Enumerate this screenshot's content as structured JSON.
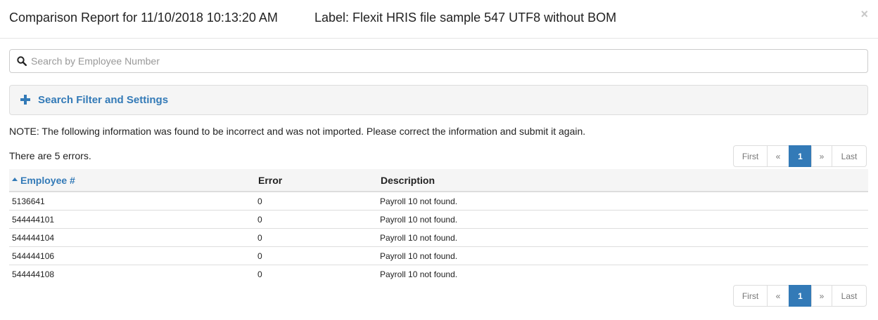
{
  "header": {
    "title": "Comparison Report for 11/10/2018 10:13:20 AM",
    "label": "Label: Flexit HRIS file sample 547 UTF8 without BOM",
    "close_glyph": "×"
  },
  "search": {
    "placeholder": "Search by Employee Number",
    "value": ""
  },
  "filter_panel": {
    "label": "Search Filter and Settings",
    "icon": "plus-icon"
  },
  "note": "NOTE: The following information was found to be incorrect and was not imported. Please correct the information and submit it again.",
  "error_count_text": "There are 5 errors.",
  "pagination": {
    "first": "First",
    "prev": "«",
    "current": "1",
    "next": "»",
    "last": "Last"
  },
  "table": {
    "columns": [
      "Employee #",
      "Error",
      "Description"
    ],
    "sort_column": "Employee #",
    "sort_direction": "ascending",
    "rows": [
      {
        "employee": "5136641",
        "error": "0",
        "description": "Payroll 10 not found."
      },
      {
        "employee": "544444101",
        "error": "0",
        "description": "Payroll 10 not found."
      },
      {
        "employee": "544444104",
        "error": "0",
        "description": "Payroll 10 not found."
      },
      {
        "employee": "544444106",
        "error": "0",
        "description": "Payroll 10 not found."
      },
      {
        "employee": "544444108",
        "error": "0",
        "description": "Payroll 10 not found."
      }
    ]
  },
  "colors": {
    "accent": "#337ab7",
    "panel_bg": "#f5f5f5",
    "border": "#dddddd"
  }
}
